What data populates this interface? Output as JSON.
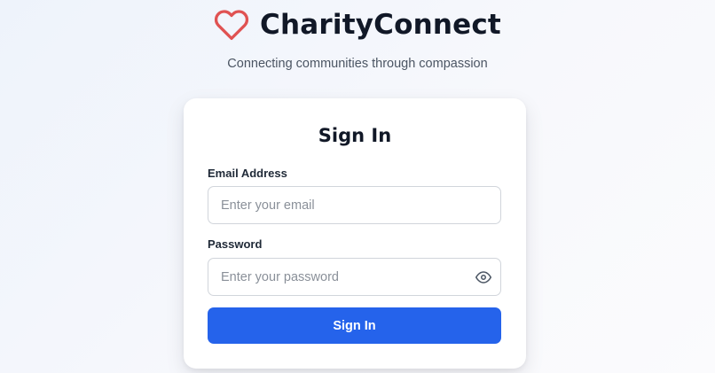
{
  "brand": {
    "title": "CharityConnect",
    "tagline": "Connecting communities through compassion",
    "logo_icon": "heart-icon",
    "logo_color": "#e05252"
  },
  "signin": {
    "title": "Sign In",
    "email": {
      "label": "Email Address",
      "value": "",
      "placeholder": "Enter your email"
    },
    "password": {
      "label": "Password",
      "value": "",
      "placeholder": "Enter your password",
      "toggle_icon": "eye-icon"
    },
    "submit_label": "Sign In",
    "accent_color": "#2563eb"
  }
}
